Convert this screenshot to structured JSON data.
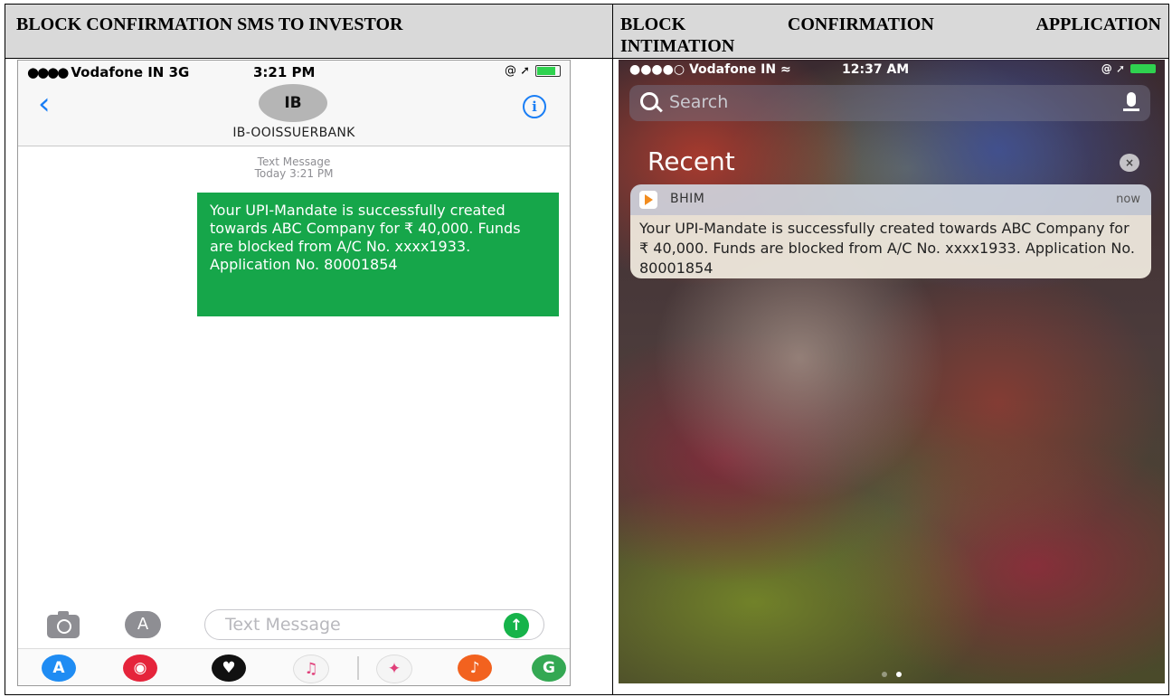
{
  "headers": {
    "left": "BLOCK CONFIRMATION SMS TO INVESTOR",
    "right_words": [
      "BLOCK",
      "CONFIRMATION",
      "APPLICATION"
    ],
    "right_line2": "INTIMATION"
  },
  "sms_phone": {
    "status": {
      "bars": "●●●●",
      "carrier": "Vodafone IN  3G",
      "time": "3:21 PM",
      "right": "@ ➚"
    },
    "avatar": "IB",
    "contact": "IB-OOISSUERBANK",
    "info": "i",
    "back": "‹",
    "meta_type": "Text Message",
    "meta_time": "Today 3:21 PM",
    "message": "Your UPI-Mandate is successfully created towards ABC Company for ₹ 40,000. Funds are blocked from A/C No. xxxx1933. Application No. 80001854",
    "compose_placeholder": "Text Message",
    "apps_glyph": "A",
    "send_glyph": "↑",
    "tray": [
      {
        "name": "app-store",
        "glyph": "A",
        "color": "#1f8cf3"
      },
      {
        "name": "search-images",
        "glyph": "◉",
        "color": "#e5243b"
      },
      {
        "name": "digital-touch",
        "glyph": "♥",
        "color": "#111111"
      },
      {
        "name": "music",
        "glyph": "♫",
        "color": "#f5f5f5"
      },
      {
        "name": "photos",
        "glyph": "✦",
        "color": "#f5f5f5"
      },
      {
        "name": "garageband",
        "glyph": "♪",
        "color": "#f2621f"
      },
      {
        "name": "maps",
        "glyph": "G",
        "color": "#34a853"
      }
    ]
  },
  "notif_phone": {
    "status": {
      "carrier": "●●●●○ Vodafone IN ≈",
      "time": "12:37 AM",
      "right": "@ ➚"
    },
    "search_label": "Search",
    "recent": "Recent",
    "clear_glyph": "×",
    "app_name": "BHIM",
    "notif_time": "now",
    "notif_body": "Your UPI-Mandate is successfully created towards ABC Company for ₹ 40,000. Funds are blocked from A/C No. xxxx1933. Application No. 80001854",
    "page_dots": [
      "inactive",
      "active"
    ]
  }
}
